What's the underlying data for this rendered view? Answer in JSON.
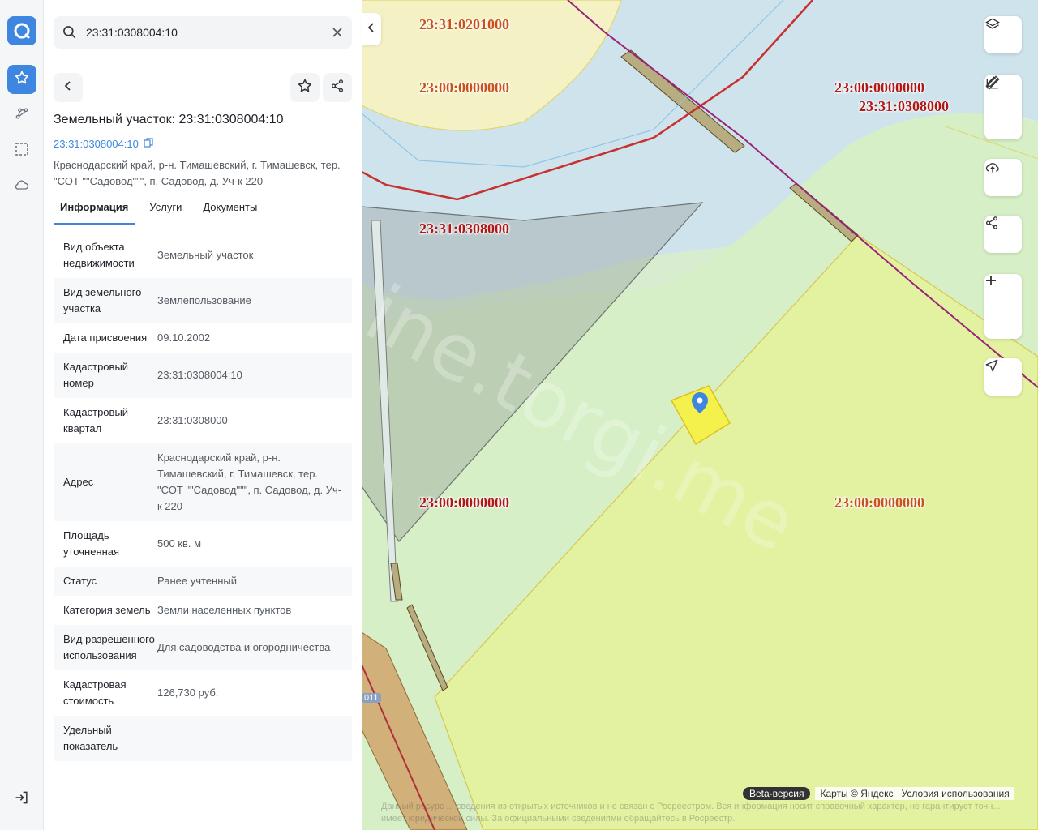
{
  "search": {
    "value": "23:31:0308004:10",
    "placeholder": ""
  },
  "object": {
    "title": "Земельный участок: 23:31:0308004:10",
    "cadastral_link": "23:31:0308004:10",
    "address": "Краснодарский край, р-н. Тимашевский, г. Тимашевск, тер. \"СОТ \"\"Садовод\"\"\", п. Садовод, д. Уч-к 220"
  },
  "tabs": [
    {
      "label": "Информация",
      "active": true
    },
    {
      "label": "Услуги",
      "active": false
    },
    {
      "label": "Документы",
      "active": false
    }
  ],
  "info_rows": [
    {
      "key": "Вид объекта недвижимости",
      "value": "Земельный участок"
    },
    {
      "key": "Вид земельного участка",
      "value": "Землепользование"
    },
    {
      "key": "Дата присвоения",
      "value": "09.10.2002"
    },
    {
      "key": "Кадастровый номер",
      "value": "23:31:0308004:10"
    },
    {
      "key": "Кадастровый квартал",
      "value": "23:31:0308000"
    },
    {
      "key": "Адрес",
      "value": "Краснодарский край, р-н. Тимашевский, г. Тимашевск, тер. \"СОТ \"\"Садовод\"\"\", п. Садовод, д. Уч-к 220"
    },
    {
      "key": "Площадь уточненная",
      "value": "500 кв. м"
    },
    {
      "key": "Статус",
      "value": "Ранее учтенный"
    },
    {
      "key": "Категория земель",
      "value": "Земли населенных пунктов"
    },
    {
      "key": "Вид разрешенного использования",
      "value": "Для садоводства и огородничества"
    },
    {
      "key": "Кадастровая стоимость",
      "value": "126,730 руб."
    },
    {
      "key": "Удельный показатель",
      "value": ""
    }
  ],
  "map": {
    "labels": [
      {
        "text": "23:31:0201000",
        "color": "orange"
      },
      {
        "text": "23:00:0000000",
        "color": "orange"
      },
      {
        "text": "23:00:0000000",
        "color": "red"
      },
      {
        "text": "23:31:0308000",
        "color": "red"
      },
      {
        "text": "23:31:0308000",
        "color": "red"
      },
      {
        "text": "23:00:0000000",
        "color": "red"
      },
      {
        "text": "23:00:0000000",
        "color": "orange"
      }
    ],
    "road_number": "011",
    "watermark": "ine.torgi.me",
    "beta_label": "Beta-версия",
    "copyright": "Карты © Яндекс",
    "terms": "Условия использования",
    "disclaimer": "Данный ресурс ... сведения из открытых источников и не связан с Росреестром. Вся информация носит справочный характер, не гарантирует точн... имеет юридической силы. За официальными сведениями обращайтесь в Росреестр."
  },
  "icons": {
    "logo": "app-logo-icon",
    "favorites": "star-icon",
    "routes": "route-icon",
    "select": "selection-icon",
    "cloud": "cloud-icon",
    "logout": "logout-icon"
  },
  "colors": {
    "accent": "#3f86e0",
    "cadastral_red": "#b01818",
    "parcel_fill": "#e2f2a0"
  }
}
